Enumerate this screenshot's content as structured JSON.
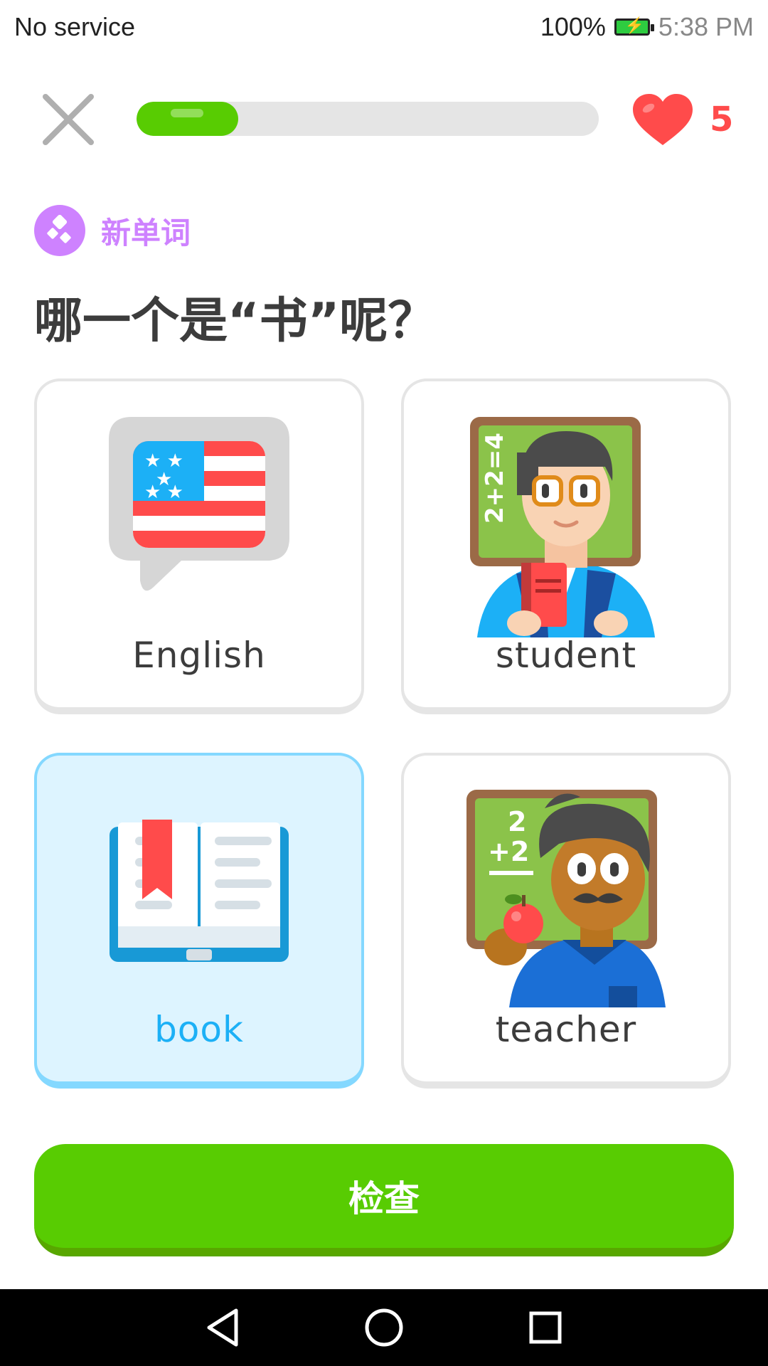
{
  "status_bar": {
    "carrier": "No service",
    "battery_percent": "100%",
    "time": "5:38 PM",
    "battery_color": "#2ecc40"
  },
  "header": {
    "close_icon": "close-icon",
    "progress": 0.22,
    "hearts_count": "5",
    "heart_color": "#ff4b4b"
  },
  "badge": {
    "label": "新单词",
    "color": "#ce82ff",
    "icon": "new-word-icon"
  },
  "question": "哪一个是“书”呢？",
  "options": [
    {
      "label": "English",
      "icon": "us-flag-speech-icon",
      "selected": false
    },
    {
      "label": "student",
      "icon": "student-illustration",
      "selected": false
    },
    {
      "label": "book",
      "icon": "open-book-icon",
      "selected": true
    },
    {
      "label": "teacher",
      "icon": "teacher-illustration",
      "selected": false
    }
  ],
  "check_button": {
    "label": "检查",
    "color": "#58cc02"
  },
  "nav_bar": {
    "back_icon": "back-triangle-icon",
    "home_icon": "home-circle-icon",
    "recents_icon": "recents-square-icon"
  }
}
